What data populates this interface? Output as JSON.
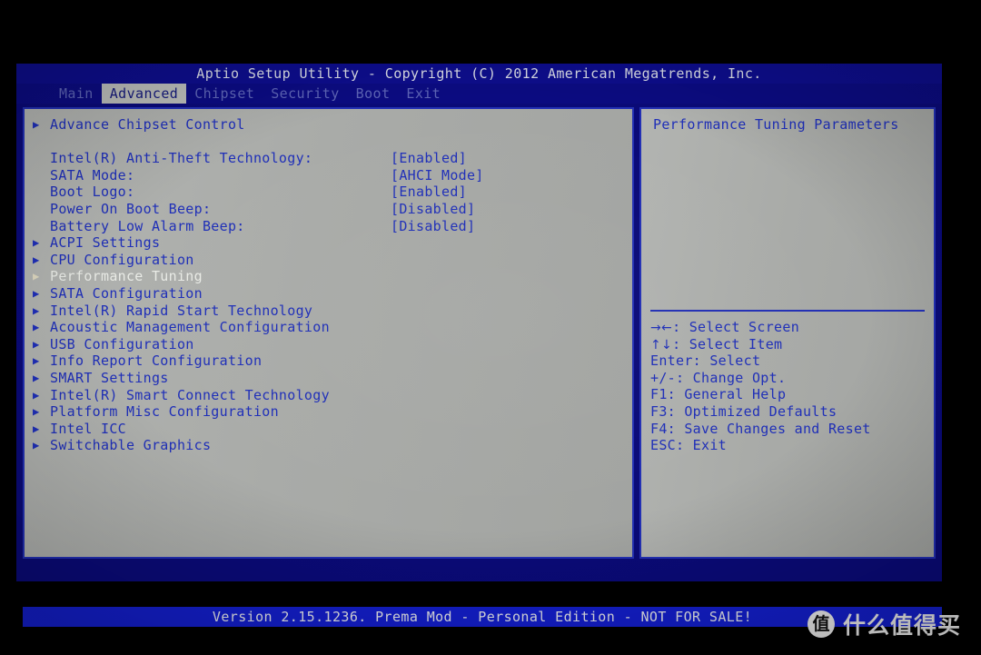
{
  "titlebar": {
    "text": "Aptio Setup Utility - Copyright (C) 2012 American Megatrends, Inc."
  },
  "tabs": [
    {
      "label": "Main",
      "active": false
    },
    {
      "label": "Advanced",
      "active": true
    },
    {
      "label": "Chipset",
      "active": false
    },
    {
      "label": "Security",
      "active": false
    },
    {
      "label": "Boot",
      "active": false
    },
    {
      "label": "Exit",
      "active": false
    }
  ],
  "menu": {
    "rows": [
      {
        "arrow": true,
        "label": "Advance Chipset Control",
        "value": "",
        "selected": false
      },
      {
        "spacer": true
      },
      {
        "arrow": false,
        "label": "Intel(R) Anti-Theft Technology:",
        "value": "[Enabled]",
        "selected": false
      },
      {
        "arrow": false,
        "label": "SATA Mode:",
        "value": "[AHCI Mode]",
        "selected": false
      },
      {
        "arrow": false,
        "label": "Boot Logo:",
        "value": "[Enabled]",
        "selected": false
      },
      {
        "arrow": false,
        "label": "Power On Boot Beep:",
        "value": "[Disabled]",
        "selected": false
      },
      {
        "arrow": false,
        "label": "Battery Low Alarm Beep:",
        "value": "[Disabled]",
        "selected": false
      },
      {
        "arrow": true,
        "label": "ACPI Settings",
        "value": "",
        "selected": false
      },
      {
        "arrow": true,
        "label": "CPU Configuration",
        "value": "",
        "selected": false
      },
      {
        "arrow": true,
        "label": "Performance Tuning",
        "value": "",
        "selected": true
      },
      {
        "arrow": true,
        "label": "SATA Configuration",
        "value": "",
        "selected": false
      },
      {
        "arrow": true,
        "label": "Intel(R) Rapid Start Technology",
        "value": "",
        "selected": false
      },
      {
        "arrow": true,
        "label": "Acoustic Management Configuration",
        "value": "",
        "selected": false
      },
      {
        "arrow": true,
        "label": "USB Configuration",
        "value": "",
        "selected": false
      },
      {
        "arrow": true,
        "label": "Info Report Configuration",
        "value": "",
        "selected": false
      },
      {
        "arrow": true,
        "label": "SMART Settings",
        "value": "",
        "selected": false
      },
      {
        "arrow": true,
        "label": "Intel(R) Smart Connect Technology",
        "value": "",
        "selected": false
      },
      {
        "arrow": true,
        "label": "Platform Misc Configuration",
        "value": "",
        "selected": false
      },
      {
        "arrow": true,
        "label": "Intel ICC",
        "value": "",
        "selected": false
      },
      {
        "arrow": true,
        "label": "Switchable Graphics",
        "value": "",
        "selected": false
      }
    ]
  },
  "help": {
    "description": "Performance Tuning Parameters",
    "keys": [
      {
        "glyph": "→←",
        "text": ": Select Screen"
      },
      {
        "glyph": "↑↓",
        "text": ": Select Item"
      },
      {
        "glyph": "",
        "text": "Enter: Select"
      },
      {
        "glyph": "",
        "text": "+/-: Change Opt."
      },
      {
        "glyph": "",
        "text": "F1: General Help"
      },
      {
        "glyph": "",
        "text": "F3: Optimized Defaults"
      },
      {
        "glyph": "",
        "text": "F4: Save Changes and Reset"
      },
      {
        "glyph": "",
        "text": "ESC: Exit"
      }
    ]
  },
  "footer": {
    "text": "Version 2.15.1236. Prema Mod - Personal Edition - NOT FOR SALE!"
  },
  "watermark": {
    "logo_char": "值",
    "text": "什么值得买"
  },
  "colors": {
    "bios_blue": "#0a0a78",
    "panel_gray": "#a9aba8",
    "text_blue": "#1f2fb8",
    "border_blue": "#2330b4",
    "selected_text": "#e9ebe6",
    "footer_blue": "#131ecb"
  }
}
